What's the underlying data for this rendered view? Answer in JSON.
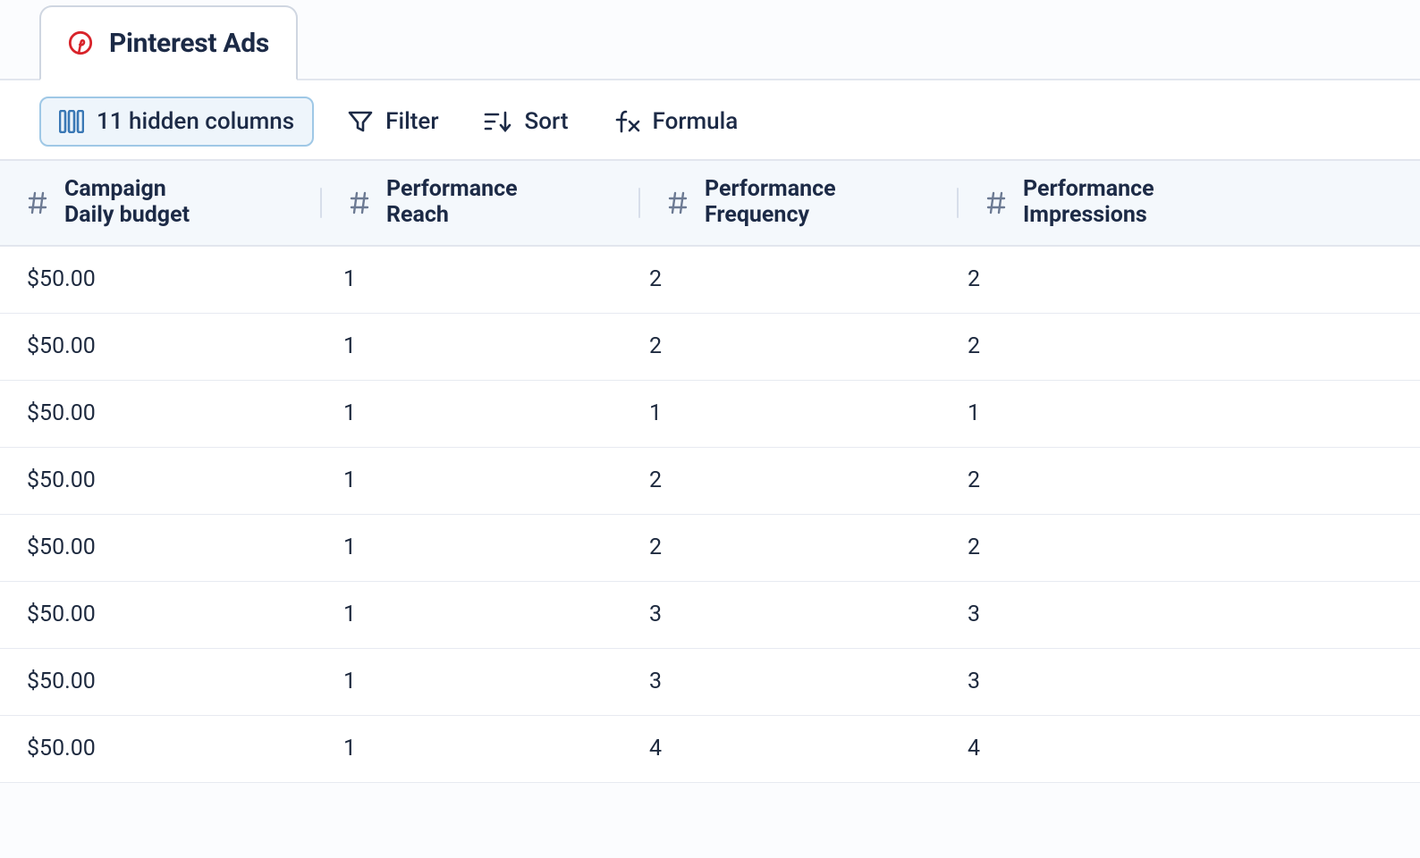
{
  "tab": {
    "label": "Pinterest Ads"
  },
  "toolbar": {
    "hidden_columns_label": "11 hidden columns",
    "filter_label": "Filter",
    "sort_label": "Sort",
    "formula_label": "Formula"
  },
  "columns": {
    "budget": {
      "line1": "Campaign",
      "line2": "Daily budget"
    },
    "reach": {
      "line1": "Performance",
      "line2": "Reach"
    },
    "freq": {
      "line1": "Performance",
      "line2": "Frequency"
    },
    "impr": {
      "line1": "Performance",
      "line2": "Impressions"
    }
  },
  "rows": [
    {
      "budget": "$50.00",
      "reach": "1",
      "freq": "2",
      "impr": "2"
    },
    {
      "budget": "$50.00",
      "reach": "1",
      "freq": "2",
      "impr": "2"
    },
    {
      "budget": "$50.00",
      "reach": "1",
      "freq": "1",
      "impr": "1"
    },
    {
      "budget": "$50.00",
      "reach": "1",
      "freq": "2",
      "impr": "2"
    },
    {
      "budget": "$50.00",
      "reach": "1",
      "freq": "2",
      "impr": "2"
    },
    {
      "budget": "$50.00",
      "reach": "1",
      "freq": "3",
      "impr": "3"
    },
    {
      "budget": "$50.00",
      "reach": "1",
      "freq": "3",
      "impr": "3"
    },
    {
      "budget": "$50.00",
      "reach": "1",
      "freq": "4",
      "impr": "4"
    }
  ]
}
